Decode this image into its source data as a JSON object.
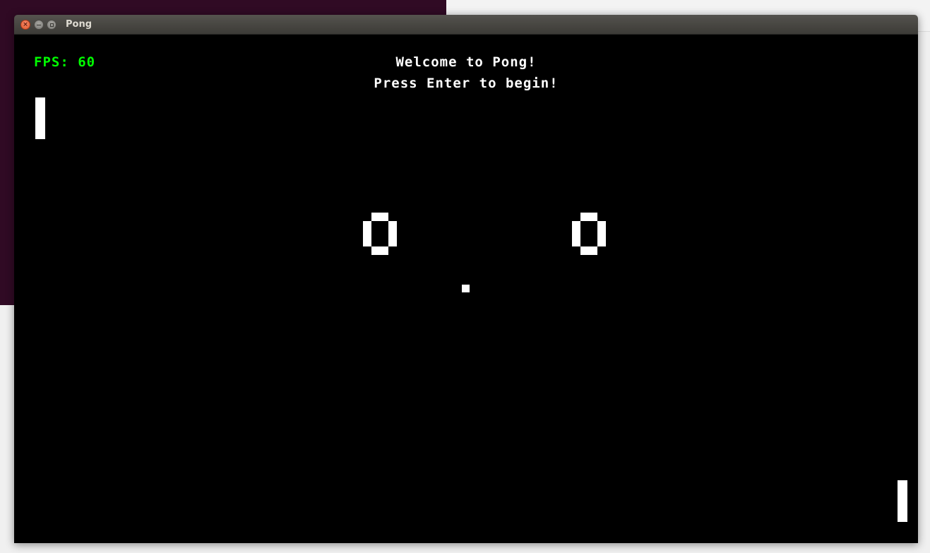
{
  "window": {
    "title": "Pong",
    "buttons": {
      "close_icon": "close-icon",
      "minimize_icon": "minimize-icon",
      "maximize_icon": "maximize-icon"
    }
  },
  "game": {
    "fps_label": "FPS: 60",
    "welcome_message": "Welcome to Pong!",
    "instruction_message": "Press Enter to begin!",
    "score_player1": "0",
    "score_player2": "0",
    "colors": {
      "background": "#000000",
      "foreground": "#ffffff",
      "fps": "#00ff00"
    }
  }
}
